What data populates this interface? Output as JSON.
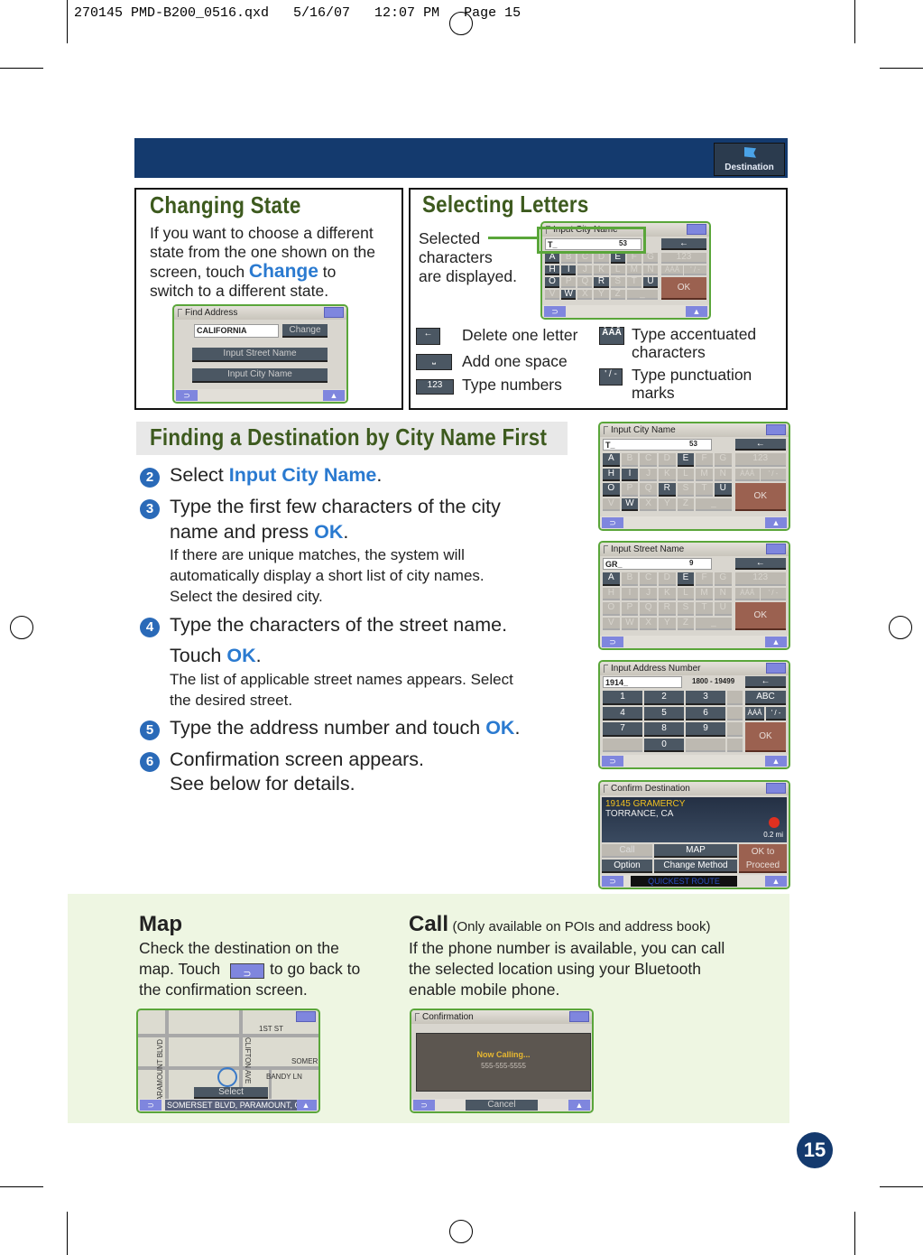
{
  "slug": "270145 PMD-B200_0516.qxd   5/16/07   12:07 PM   Page 15",
  "header": {
    "destination_label": "Destination",
    "destination_icon": "flag-icon",
    "color": "#143a6e"
  },
  "changing_state": {
    "title": "Changing State",
    "lines": [
      "If you want to choose a different",
      "state from the one shown on the",
      "screen, touch ",
      " to",
      "switch to a different state."
    ],
    "highlight": "Change",
    "screen": {
      "title": "Find Address",
      "state": "CALIFORNIA",
      "change": "Change",
      "street": "Input Street Name",
      "city": "Input City Name"
    }
  },
  "selecting_letters": {
    "title": "Selecting Letters",
    "callout": [
      "Selected",
      "characters",
      "are displayed."
    ],
    "screen": {
      "title": "Input City Name",
      "value": "T_",
      "count": "53"
    },
    "legend": [
      {
        "icon": "backspace-icon",
        "glyph": "←",
        "text": "Delete one letter"
      },
      {
        "icon": "space-icon",
        "glyph": "⎵",
        "text": "Add one space"
      },
      {
        "icon": "numbers-icon",
        "glyph": "123",
        "text": "Type numbers"
      },
      {
        "icon": "accent-icon",
        "glyph": "ÀÁÂ",
        "text": "Type accentuated characters"
      },
      {
        "icon": "punctuation-icon",
        "glyph": "' / -",
        "text": "Type punctuation marks"
      }
    ]
  },
  "finding": {
    "title": "Finding a Destination by City Name First",
    "steps": [
      {
        "n": "2",
        "text": "Select ",
        "hl": "Input City Name",
        "after": "."
      },
      {
        "n": "3",
        "text": "Type the first few characters of the city",
        "text2": "name and press ",
        "hl": "OK",
        "after": ".",
        "sub": [
          "If there are unique matches, the system will",
          "automatically display a short list of city names.",
          "Select the desired city."
        ]
      },
      {
        "n": "4",
        "text": "Type the characters of the street name.",
        "text2": "Touch ",
        "hl": "OK",
        "after": ".",
        "sub": [
          "The list of applicable street names appears. Select",
          "the desired street."
        ]
      },
      {
        "n": "5",
        "text": "Type the address number and touch ",
        "hl": "OK",
        "after": "."
      },
      {
        "n": "6",
        "text": "Confirmation screen appears.",
        "text2": "See below for details."
      }
    ]
  },
  "screens": {
    "city": {
      "title": "Input City Name",
      "value": "T_",
      "count": "53",
      "active": [
        "A",
        "E",
        "H",
        "I",
        "O",
        "R",
        "U",
        "W"
      ]
    },
    "street": {
      "title": "Input Street Name",
      "value": "GR_",
      "count": "9",
      "active": [
        "A",
        "E"
      ]
    },
    "address": {
      "title": "Input Address Number",
      "value": "1914_",
      "range": "1800 - 19499",
      "keys": [
        "1",
        "2",
        "3",
        "4",
        "5",
        "6",
        "7",
        "8",
        "9",
        "0"
      ],
      "abc": "ABC",
      "accent": "ÀÁÂ",
      "punct": "' / -",
      "ok": "OK"
    },
    "confirm": {
      "title": "Confirm Destination",
      "line1": "19145 GRAMERCY",
      "line2": "TORRANCE, CA",
      "dist": "0.2 mi",
      "call": "Call",
      "map": "MAP",
      "option": "Option",
      "change": "Change Method",
      "ok": "OK to Proceed",
      "route": "QUICKEST ROUTE"
    },
    "keyboard": {
      "rows": [
        [
          "A",
          "B",
          "C",
          "D",
          "E",
          "F",
          "G"
        ],
        [
          "H",
          "I",
          "J",
          "K",
          "L",
          "M",
          "N"
        ],
        [
          "O",
          "P",
          "Q",
          "R",
          "S",
          "T",
          "U"
        ],
        [
          "V",
          "W",
          "X",
          "Y",
          "Z",
          "_"
        ]
      ],
      "num": "123",
      "accent": "ÀÁÂ",
      "punct": "' / -",
      "ok": "OK"
    }
  },
  "map": {
    "title": "Map",
    "lines": [
      "Check the destination on the",
      "map. Touch ",
      "to go back to",
      "the confirmation screen."
    ],
    "screen": {
      "streets": [
        "1ST ST",
        "SOMER",
        "BANDY LN",
        "PARAMOUNT BLVD",
        "CLIFTON AVE"
      ],
      "select": "Select",
      "address": "SOMERSET BLVD, PARAMOUNT, CA"
    }
  },
  "call": {
    "title": "Call",
    "note": "(Only available on POIs and address book)",
    "lines": [
      "If the phone number is available, you can call",
      "the selected location using your Bluetooth",
      "enable mobile phone."
    ],
    "screen": {
      "title": "Confirmation",
      "calling": "Now Calling...",
      "number": "555-555-5555",
      "cancel": "Cancel"
    }
  },
  "page_number": "15"
}
